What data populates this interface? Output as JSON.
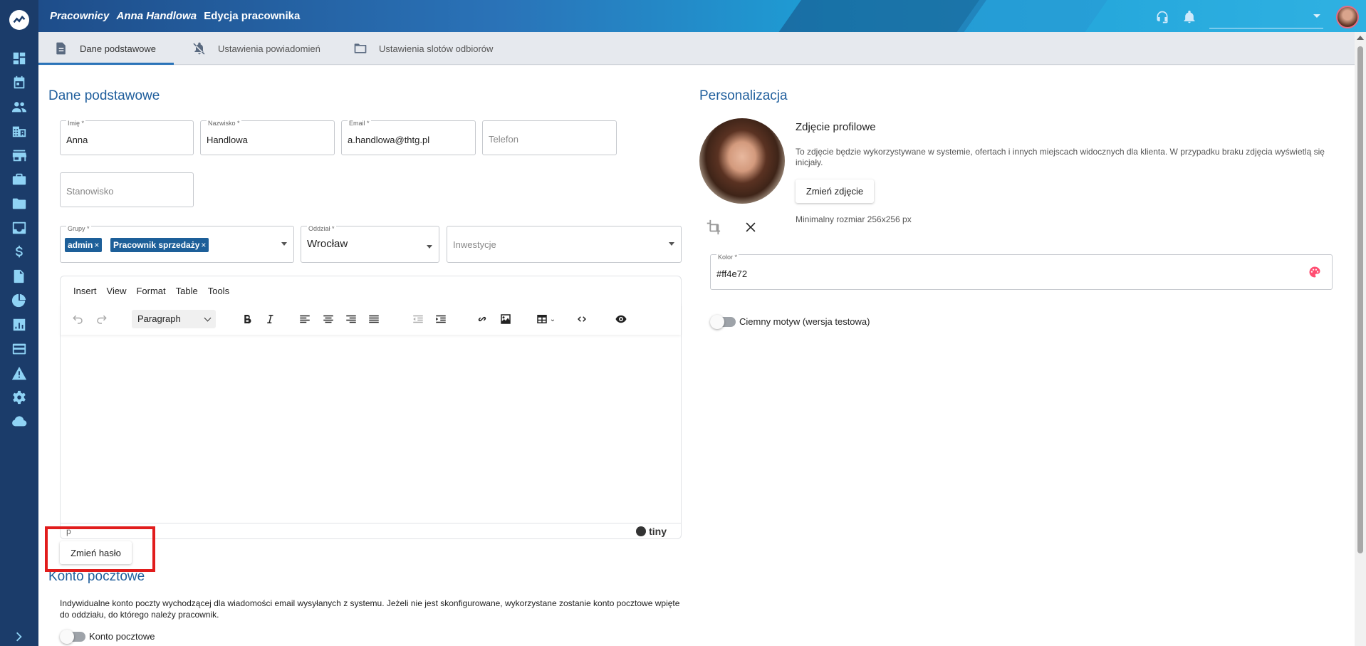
{
  "topbar": {
    "breadcrumb": [
      "Pracownicy",
      "Anna Handlowa"
    ],
    "page_title": "Edycja pracownika"
  },
  "tabs": [
    {
      "label": "Dane podstawowe",
      "icon": "document-icon",
      "active": true
    },
    {
      "label": "Ustawienia powiadomień",
      "icon": "notifications-off-icon",
      "active": false
    },
    {
      "label": "Ustawienia slotów odbiorów",
      "icon": "folder-icon",
      "active": false
    }
  ],
  "basic": {
    "title": "Dane podstawowe",
    "first_name": {
      "label": "Imię *",
      "value": "Anna"
    },
    "last_name": {
      "label": "Nazwisko *",
      "value": "Handlowa"
    },
    "email": {
      "label": "Email *",
      "value": "a.handlowa@thtg.pl"
    },
    "phone": {
      "placeholder": "Telefon"
    },
    "position": {
      "placeholder": "Stanowisko"
    },
    "groups": {
      "label": "Grupy *",
      "chips": [
        "admin",
        "Pracownik sprzedaży"
      ],
      "remove": "×"
    },
    "branch": {
      "label": "Oddział *",
      "value": "Wrocław"
    },
    "investments": {
      "placeholder": "Inwestycje"
    }
  },
  "editor": {
    "menu": [
      "Insert",
      "View",
      "Format",
      "Table",
      "Tools"
    ],
    "block_format": "Paragraph",
    "status_path": "p",
    "brand": "tiny"
  },
  "change_password_label": "Zmień hasło",
  "mail": {
    "title": "Konto pocztowe",
    "description": "Indywidualne konto poczty wychodzącej dla wiadomości email wysyłanych z systemu. Jeżeli nie jest skonfigurowane, wykorzystane zostanie konto pocztowe wpięte do oddziału, do którego należy pracownik.",
    "toggle_label": "Konto pocztowe",
    "toggle_on": false
  },
  "personalization": {
    "title": "Personalizacja",
    "photo_title": "Zdjęcie profilowe",
    "photo_desc": "To zdjęcie będzie wykorzystywane w systemie, ofertach i innych miejscach widocznych dla klienta. W przypadku braku zdjęcia wyświetlą się inicjały.",
    "change_photo_label": "Zmień zdjęcie",
    "min_size": "Minimalny rozmiar 256x256 px",
    "color": {
      "label": "Kolor *",
      "value": "#ff4e72"
    },
    "dark_theme_label": "Ciemny motyw (wersja testowa)",
    "dark_theme_on": false
  },
  "colors": {
    "accent": "#2a73b8",
    "sidebar": "#1b3c6a",
    "heading": "#1f5e9c",
    "highlight": "#e11c1c"
  }
}
